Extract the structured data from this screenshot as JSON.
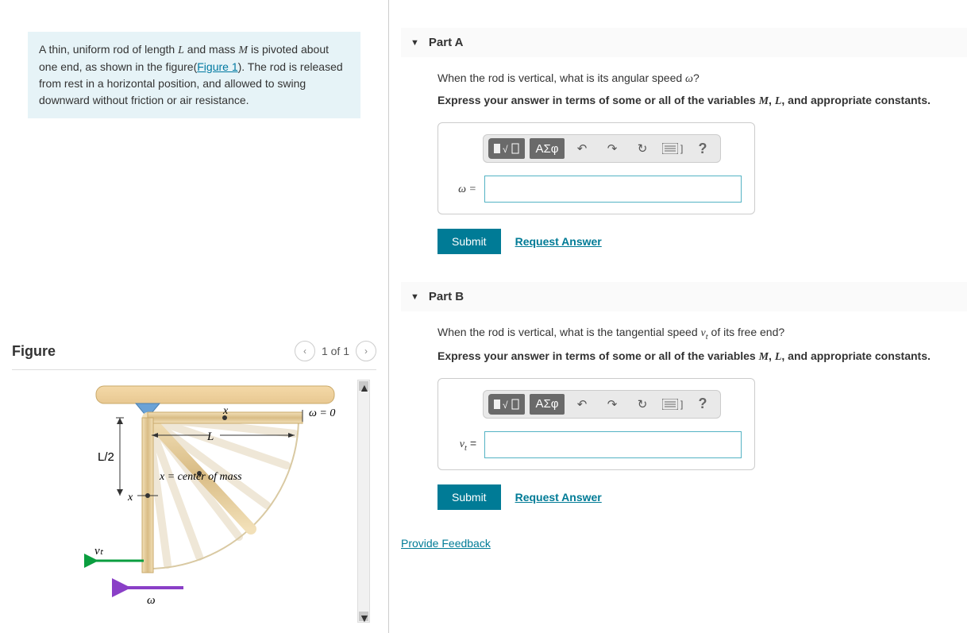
{
  "problem": {
    "text_before_link": "A thin, uniform rod of length ",
    "L": "L",
    "text_mid1": " and mass ",
    "M": "M",
    "text_mid2": " is pivoted about one end, as shown in the figure(",
    "figure_link": "Figure 1",
    "text_after_link": "). The rod is released from rest in a horizontal position, and allowed to swing downward without friction or air resistance."
  },
  "figure": {
    "heading": "Figure",
    "counter": "1 of 1",
    "labels": {
      "omega0": "ω = 0",
      "x": "x",
      "L": "L",
      "Lhalf": "L/2",
      "cm": "x = center of mass",
      "x2": "x",
      "vt": "vₜ",
      "omega": "ω"
    }
  },
  "partA": {
    "title": "Part A",
    "question_pre": "When the rod is vertical, what is its angular speed ",
    "question_sym": "ω",
    "question_post": "?",
    "instructions_pre": "Express your answer in terms of some or all of the variables ",
    "instructions_post": ", and appropriate constants.",
    "var_M": "M",
    "var_L": "L",
    "label": "ω =",
    "submit": "Submit",
    "request": "Request Answer"
  },
  "partB": {
    "title": "Part B",
    "question_pre": "When the rod is vertical, what is the tangential speed ",
    "question_sym": "v",
    "question_sub": "t",
    "question_post": " of its free end?",
    "instructions_pre": "Express your answer in terms of some or all of the variables ",
    "instructions_post": ", and appropriate constants.",
    "var_M": "M",
    "var_L": "L",
    "label_v": "v",
    "label_t": "t",
    "label_eq": " =",
    "submit": "Submit",
    "request": "Request Answer"
  },
  "toolbar": {
    "templates": "■√□",
    "greek": "ΑΣφ",
    "undo": "↶",
    "redo": "↷",
    "reset": "↻",
    "keyboard": "⌨ ]",
    "help": "?"
  },
  "feedback": {
    "link": "Provide Feedback"
  }
}
